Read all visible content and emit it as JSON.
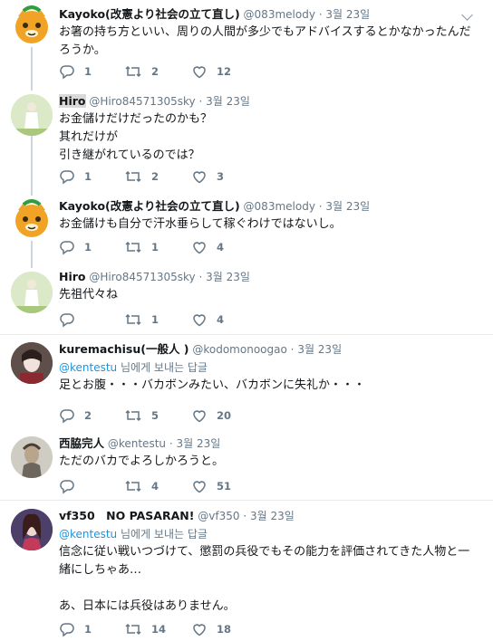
{
  "tweets": [
    {
      "name": "Kayoko(改憲より社会の立て直し)",
      "handle": "@083melody",
      "time": "3월 23일",
      "text": "お箸の持ち方といい、周りの人間が多少でもアドバイスするとかなかったんだろうか。",
      "reply": "1",
      "retweet": "2",
      "like": "12"
    },
    {
      "name": "Hiro",
      "handle": "@Hiro84571305sky",
      "time": "3월 23일",
      "text": "お金儲けだけだったのかも？\n其れだけが\n引き継がれているのでは？",
      "reply": "1",
      "retweet": "2",
      "like": "3"
    },
    {
      "name": "Kayoko(改憲より社会の立て直し)",
      "handle": "@083melody",
      "time": "3월 23일",
      "text": "お金儲けも自分で汗水垂らして稼ぐわけではないし。",
      "reply": "1",
      "retweet": "1",
      "like": "4"
    },
    {
      "name": "Hiro",
      "handle": "@Hiro84571305sky",
      "time": "3월 23일",
      "text": "先祖代々ね",
      "reply": "",
      "retweet": "1",
      "like": "4"
    },
    {
      "name": "kuremachisu(一般人 )",
      "handle": "@kodomonoogao",
      "time": "3월 23일",
      "reply_mention": "@kentestu",
      "reply_suffix": " 님에게 보내는 답글",
      "text": "足とお腹・・・バカボンみたい、バカボンに失礼か・・・",
      "reply": "2",
      "retweet": "5",
      "like": "20"
    },
    {
      "name": "西脇完人",
      "handle": "@kentestu",
      "time": "3월 23일",
      "text": "ただのバカでよろしかろうと。",
      "reply": "",
      "retweet": "4",
      "like": "51"
    },
    {
      "name": "vf350　NO PASARAN!",
      "handle": "@vf350",
      "time": "3월 23일",
      "reply_mention": "@kentestu",
      "reply_suffix": " 님에게 보내는 답글",
      "text": "信念に従い戦いつづけて、懲罰の兵役でもその能力を評価されてきた人物と一緒にしちゃあ…\n\nあ、日本には兵役はありません。",
      "reply": "1",
      "retweet": "14",
      "like": "18"
    }
  ],
  "colors": {
    "secondary_text": "#657786",
    "link": "#1b95e0",
    "thread_line": "#cbd6dd",
    "divider": "#e6ecf0"
  },
  "icons": {
    "reply": "reply-icon",
    "retweet": "retweet-icon",
    "like": "heart-icon",
    "menu": "chevron-down-icon"
  }
}
